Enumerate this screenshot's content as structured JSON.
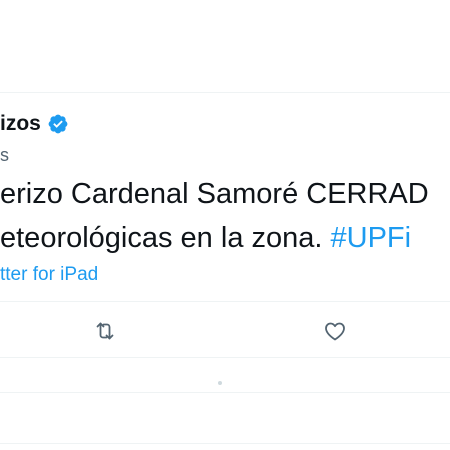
{
  "tweet": {
    "author_name": "izos",
    "handle": "s",
    "text_line1": "erizo Cardenal Samoré CERRAD",
    "text_line2_prefix": "eteorológicas en la zona. ",
    "text_line2_hashtag": "#UPFi",
    "source": "tter for iPad"
  },
  "icons": {
    "verified": "verified-badge-icon",
    "retweet": "retweet-icon",
    "like": "heart-icon"
  },
  "colors": {
    "accent": "#1d9bf0",
    "text": "#0f1419",
    "secondary": "#536471",
    "divider": "#eff3f4"
  }
}
